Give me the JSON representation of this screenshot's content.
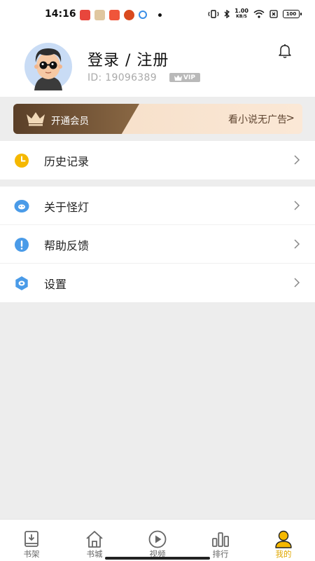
{
  "status_bar": {
    "time": "14:16",
    "net_speed_value": "1.00",
    "net_speed_unit": "KB/S",
    "battery": "100",
    "app_colors": [
      "#e8463c",
      "#e0c7a0",
      "#f0553a",
      "#d94a1f",
      "#3a8ee6"
    ]
  },
  "profile": {
    "title": "登录 / 注册",
    "user_id": "ID: 19096389",
    "vip_badge": "VIP"
  },
  "vip_banner": {
    "label": "开通会员",
    "promo": "看小说无广告",
    "arrow": ">"
  },
  "menu_group_1": [
    {
      "label": "历史记录",
      "icon": "clock-icon",
      "color": "#f5b800"
    }
  ],
  "menu_group_2": [
    {
      "label": "关于怪灯",
      "icon": "info-face-icon",
      "color": "#4a9be8"
    },
    {
      "label": "帮助反馈",
      "icon": "help-icon",
      "color": "#4a9be8"
    },
    {
      "label": "设置",
      "icon": "gear-icon",
      "color": "#4a9be8"
    }
  ],
  "bottom_nav": [
    {
      "label": "书架",
      "icon": "bookshelf-icon",
      "active": false
    },
    {
      "label": "书城",
      "icon": "bookstore-icon",
      "active": false
    },
    {
      "label": "视频",
      "icon": "video-icon",
      "active": false
    },
    {
      "label": "排行",
      "icon": "ranking-icon",
      "active": false
    },
    {
      "label": "我的",
      "icon": "profile-icon",
      "active": true
    }
  ],
  "colors": {
    "accent": "#e1a800",
    "vip_dark": "#5a3f28",
    "vip_light": "#f4dcc4",
    "menu_icon_blue": "#4a9be8",
    "menu_icon_yellow": "#f5b800"
  }
}
